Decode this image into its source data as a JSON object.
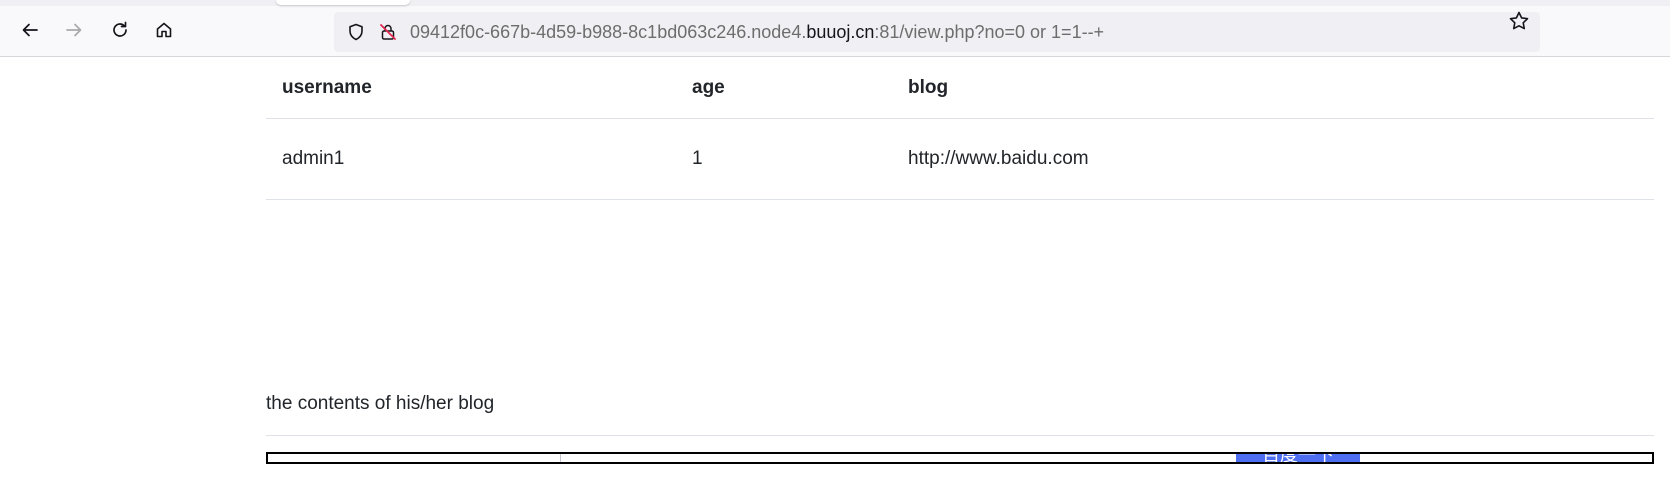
{
  "browser": {
    "url_prefix": "09412f0c-667b-4d59-b988-8c1bd063c246.node4.",
    "url_domain": "buuoj.cn",
    "url_suffix": ":81/view.php?no=0 or 1=1--+",
    "icons": [
      "back-arrow-icon",
      "forward-arrow-icon",
      "reload-icon",
      "home-icon",
      "shield-icon",
      "insecure-lock-icon",
      "star-icon"
    ]
  },
  "table": {
    "headers": [
      "username",
      "age",
      "blog"
    ],
    "rows": [
      [
        "admin1",
        "1",
        "http://www.baidu.com"
      ]
    ]
  },
  "blog_section": {
    "caption": "the contents of his/her blog",
    "embedded_button_label": "百度一下",
    "button_color": "#4e6ef2"
  }
}
